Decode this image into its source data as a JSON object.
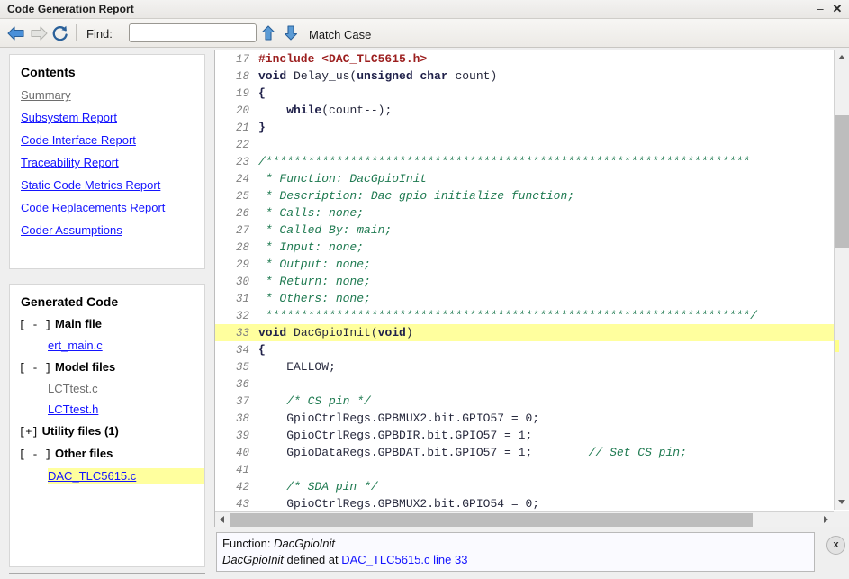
{
  "window": {
    "title": "Code Generation Report",
    "minimize_label": "–",
    "close_label": "✕"
  },
  "toolbar": {
    "back_icon": "back-arrow-icon",
    "forward_icon": "forward-arrow-icon",
    "reload_icon": "reload-icon",
    "find_label": "Find:",
    "find_value": "",
    "find_placeholder": "",
    "find_prev_icon": "arrow-up-icon",
    "find_next_icon": "arrow-down-icon",
    "match_case_label": "Match Case"
  },
  "sidebar": {
    "contents": {
      "title": "Contents",
      "items": [
        {
          "label": "Summary",
          "visited": true
        },
        {
          "label": "Subsystem Report",
          "visited": false
        },
        {
          "label": "Code Interface Report",
          "visited": false
        },
        {
          "label": "Traceability Report",
          "visited": false
        },
        {
          "label": "Static Code Metrics Report",
          "visited": false
        },
        {
          "label": "Code Replacements Report",
          "visited": false
        },
        {
          "label": "Coder Assumptions",
          "visited": false
        }
      ]
    },
    "generated_code": {
      "title": "Generated Code",
      "groups": [
        {
          "toggle": "[ - ]",
          "label": "Main file",
          "files": [
            {
              "label": "ert_main.c",
              "visited": false,
              "highlight": false
            }
          ]
        },
        {
          "toggle": "[ - ]",
          "label": "Model files",
          "files": [
            {
              "label": "LCTtest.c",
              "visited": true,
              "highlight": false
            },
            {
              "label": "LCTtest.h",
              "visited": false,
              "highlight": false
            }
          ]
        },
        {
          "toggle": "[+]",
          "label": "Utility files (1)",
          "files": []
        },
        {
          "toggle": "[ - ]",
          "label": "Other files",
          "files": [
            {
              "label": "DAC_TLC5615.c",
              "visited": false,
              "highlight": true
            }
          ]
        }
      ]
    }
  },
  "code": {
    "highlight_line": 33,
    "lines": [
      {
        "n": 17,
        "tokens": [
          {
            "t": "#include <DAC_TLC5615.h>",
            "c": "c-pre"
          }
        ]
      },
      {
        "n": 18,
        "tokens": [
          {
            "t": "void",
            "c": "c-kw"
          },
          {
            "t": " Delay_us(",
            "c": "c-plain"
          },
          {
            "t": "unsigned char",
            "c": "c-kw"
          },
          {
            "t": " count)",
            "c": "c-plain"
          }
        ]
      },
      {
        "n": 19,
        "tokens": [
          {
            "t": "{",
            "c": "c-kw"
          }
        ]
      },
      {
        "n": 20,
        "tokens": [
          {
            "t": "    ",
            "c": "c-plain"
          },
          {
            "t": "while",
            "c": "c-kw"
          },
          {
            "t": "(count--);",
            "c": "c-plain"
          }
        ]
      },
      {
        "n": 21,
        "tokens": [
          {
            "t": "}",
            "c": "c-kw"
          }
        ]
      },
      {
        "n": 22,
        "tokens": [
          {
            "t": "",
            "c": "c-plain"
          }
        ]
      },
      {
        "n": 23,
        "tokens": [
          {
            "t": "/*********************************************************************",
            "c": "c-cmt"
          }
        ]
      },
      {
        "n": 24,
        "tokens": [
          {
            "t": " * Function: DacGpioInit",
            "c": "c-cmt"
          }
        ]
      },
      {
        "n": 25,
        "tokens": [
          {
            "t": " * Description: Dac gpio initialize function;",
            "c": "c-cmt"
          }
        ]
      },
      {
        "n": 26,
        "tokens": [
          {
            "t": " * Calls: none;",
            "c": "c-cmt"
          }
        ]
      },
      {
        "n": 27,
        "tokens": [
          {
            "t": " * Called By: main;",
            "c": "c-cmt"
          }
        ]
      },
      {
        "n": 28,
        "tokens": [
          {
            "t": " * Input: none;",
            "c": "c-cmt"
          }
        ]
      },
      {
        "n": 29,
        "tokens": [
          {
            "t": " * Output: none;",
            "c": "c-cmt"
          }
        ]
      },
      {
        "n": 30,
        "tokens": [
          {
            "t": " * Return: none;",
            "c": "c-cmt"
          }
        ]
      },
      {
        "n": 31,
        "tokens": [
          {
            "t": " * Others: none;",
            "c": "c-cmt"
          }
        ]
      },
      {
        "n": 32,
        "tokens": [
          {
            "t": " *********************************************************************/",
            "c": "c-cmt"
          }
        ]
      },
      {
        "n": 33,
        "tokens": [
          {
            "t": "void",
            "c": "c-kw"
          },
          {
            "t": " DacGpioInit(",
            "c": "c-plain"
          },
          {
            "t": "void",
            "c": "c-kw"
          },
          {
            "t": ")",
            "c": "c-plain"
          }
        ]
      },
      {
        "n": 34,
        "tokens": [
          {
            "t": "{",
            "c": "c-kw"
          }
        ]
      },
      {
        "n": 35,
        "tokens": [
          {
            "t": "    EALLOW;",
            "c": "c-plain"
          }
        ]
      },
      {
        "n": 36,
        "tokens": [
          {
            "t": "",
            "c": "c-plain"
          }
        ]
      },
      {
        "n": 37,
        "tokens": [
          {
            "t": "    ",
            "c": "c-plain"
          },
          {
            "t": "/* CS pin */",
            "c": "c-cmt"
          }
        ]
      },
      {
        "n": 38,
        "tokens": [
          {
            "t": "    GpioCtrlRegs.GPBMUX2.bit.GPIO57 = 0;",
            "c": "c-plain"
          }
        ]
      },
      {
        "n": 39,
        "tokens": [
          {
            "t": "    GpioCtrlRegs.GPBDIR.bit.GPIO57 = 1;",
            "c": "c-plain"
          }
        ]
      },
      {
        "n": 40,
        "tokens": [
          {
            "t": "    GpioDataRegs.GPBDAT.bit.GPIO57 = 1;        ",
            "c": "c-plain"
          },
          {
            "t": "// Set CS pin;",
            "c": "c-cmt"
          }
        ]
      },
      {
        "n": 41,
        "tokens": [
          {
            "t": "",
            "c": "c-plain"
          }
        ]
      },
      {
        "n": 42,
        "tokens": [
          {
            "t": "    ",
            "c": "c-plain"
          },
          {
            "t": "/* SDA pin */",
            "c": "c-cmt"
          }
        ]
      },
      {
        "n": 43,
        "tokens": [
          {
            "t": "    GpioCtrlRegs.GPBMUX2.bit.GPIO54 = 0;",
            "c": "c-plain"
          }
        ]
      }
    ]
  },
  "info_panel": {
    "line1_prefix": "Function: ",
    "line1_name": "DacGpioInit",
    "line2_name": "DacGpioInit",
    "line2_mid": " defined at ",
    "line2_link": "DAC_TLC5615.c line 33",
    "close_label": "x"
  }
}
